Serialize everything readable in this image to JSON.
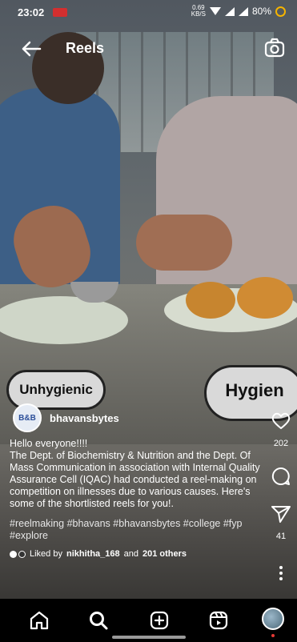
{
  "status_bar": {
    "time": "23:02",
    "speed_top": "0.69",
    "speed_bottom": "KB/S",
    "battery": "80%"
  },
  "header": {
    "title": "Reels"
  },
  "stickers": {
    "left": "Unhygienic",
    "right": "Hygien"
  },
  "author": {
    "avatar_text": "B&B",
    "username": "bhavansbytes"
  },
  "caption": {
    "line1": "Hello everyone!!!!",
    "body": "The Dept. of Biochemistry & Nutrition and the Dept. Of Mass Communication in association with Internal Quality Assurance Cell (IQAC) had conducted a reel-making on competition on illnesses due to various causes. Here's some of the shortlisted reels for you!.",
    "hashtags": "#reelmaking #bhavans #bhavansbytes #college #fyp #explore"
  },
  "likes": {
    "prefix": "Liked by",
    "user": "nikhitha_168",
    "middle": "and",
    "others": "201 others"
  },
  "actions": {
    "like_count": "202",
    "share_count": "41"
  },
  "nav": {
    "items": [
      "home-icon",
      "search-icon",
      "create-icon",
      "reels-icon",
      "profile-avatar"
    ]
  },
  "colors": {
    "record_indicator": "#d32f2f",
    "battery_ring": "#f5b400",
    "notification_dot": "#e53935"
  }
}
